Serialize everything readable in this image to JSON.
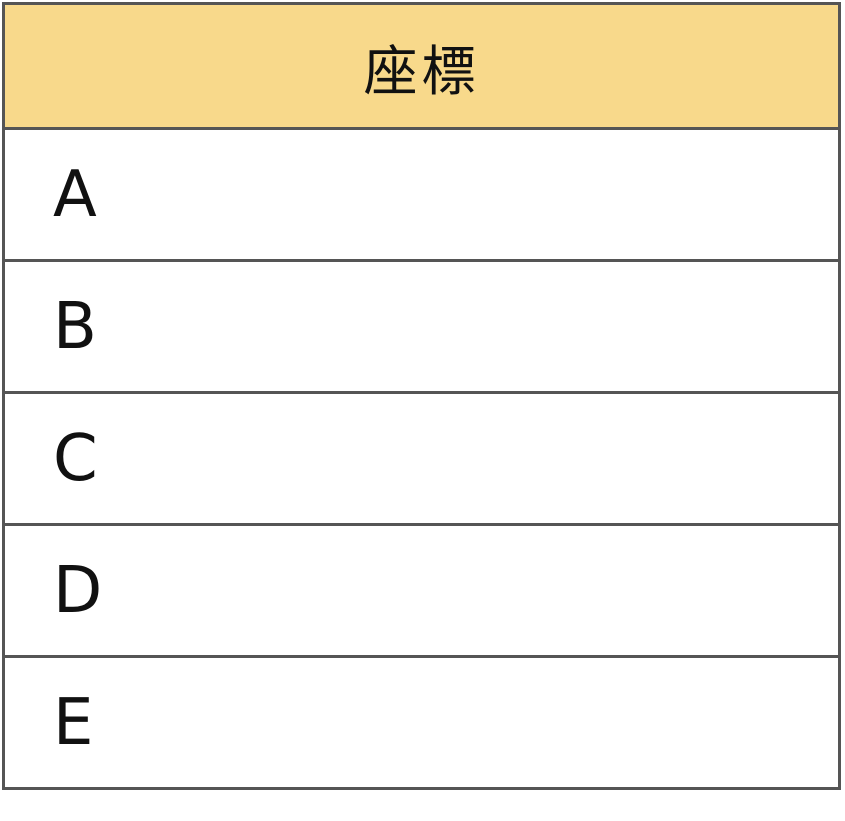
{
  "table": {
    "header": "座標",
    "rows": [
      {
        "label": "A"
      },
      {
        "label": "B"
      },
      {
        "label": "C"
      },
      {
        "label": "D"
      },
      {
        "label": "E"
      }
    ]
  },
  "colors": {
    "header_background": "#f8d98b",
    "border": "#555555",
    "text": "#111111"
  }
}
